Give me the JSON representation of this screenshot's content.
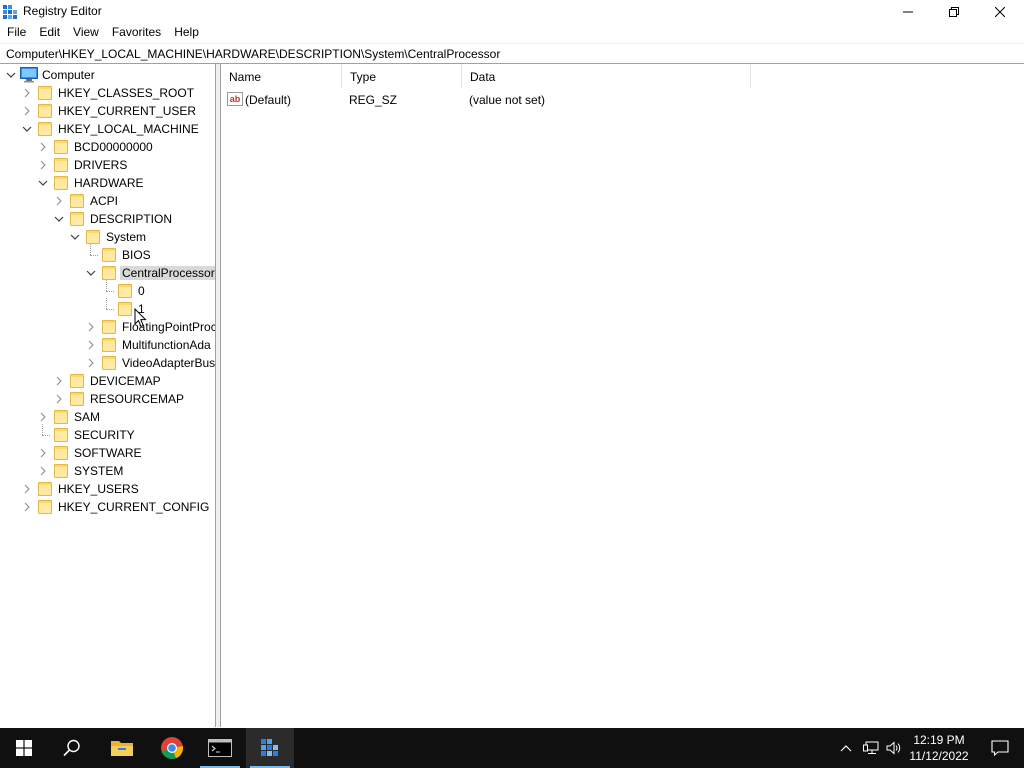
{
  "window": {
    "title": "Registry Editor",
    "icon": "regedit-icon",
    "controls": {
      "minimize": "minimize-icon",
      "maximize": "restore-icon",
      "close": "close-icon"
    }
  },
  "menu": [
    "File",
    "Edit",
    "View",
    "Favorites",
    "Help"
  ],
  "address": "Computer\\HKEY_LOCAL_MACHINE\\HARDWARE\\DESCRIPTION\\System\\CentralProcessor",
  "tree": [
    {
      "label": "Computer",
      "depth": 0,
      "state": "expanded",
      "icon": "computer-icon"
    },
    {
      "label": "HKEY_CLASSES_ROOT",
      "depth": 1,
      "state": "collapsed"
    },
    {
      "label": "HKEY_CURRENT_USER",
      "depth": 1,
      "state": "collapsed"
    },
    {
      "label": "HKEY_LOCAL_MACHINE",
      "depth": 1,
      "state": "expanded"
    },
    {
      "label": "BCD00000000",
      "depth": 2,
      "state": "collapsed"
    },
    {
      "label": "DRIVERS",
      "depth": 2,
      "state": "collapsed"
    },
    {
      "label": "HARDWARE",
      "depth": 2,
      "state": "expanded"
    },
    {
      "label": "ACPI",
      "depth": 3,
      "state": "collapsed"
    },
    {
      "label": "DESCRIPTION",
      "depth": 3,
      "state": "expanded"
    },
    {
      "label": "System",
      "depth": 4,
      "state": "expanded"
    },
    {
      "label": "BIOS",
      "depth": 5,
      "state": "leaf"
    },
    {
      "label": "CentralProcessor",
      "depth": 5,
      "state": "expanded",
      "selected": true
    },
    {
      "label": "0",
      "depth": 6,
      "state": "leaf"
    },
    {
      "label": "1",
      "depth": 6,
      "state": "leaf"
    },
    {
      "label": "FloatingPointProc",
      "depth": 5,
      "state": "collapsed"
    },
    {
      "label": "MultifunctionAda",
      "depth": 5,
      "state": "collapsed"
    },
    {
      "label": "VideoAdapterBus",
      "depth": 5,
      "state": "collapsed"
    },
    {
      "label": "DEVICEMAP",
      "depth": 3,
      "state": "collapsed"
    },
    {
      "label": "RESOURCEMAP",
      "depth": 3,
      "state": "collapsed"
    },
    {
      "label": "SAM",
      "depth": 2,
      "state": "collapsed"
    },
    {
      "label": "SECURITY",
      "depth": 2,
      "state": "leaf"
    },
    {
      "label": "SOFTWARE",
      "depth": 2,
      "state": "collapsed"
    },
    {
      "label": "SYSTEM",
      "depth": 2,
      "state": "collapsed"
    },
    {
      "label": "HKEY_USERS",
      "depth": 1,
      "state": "collapsed"
    },
    {
      "label": "HKEY_CURRENT_CONFIG",
      "depth": 1,
      "state": "collapsed"
    }
  ],
  "list": {
    "columns": [
      "Name",
      "Type",
      "Data"
    ],
    "rows": [
      {
        "icon": "string-value-icon",
        "icon_text": "ab",
        "name": "(Default)",
        "type": "REG_SZ",
        "data": "(value not set)"
      }
    ]
  },
  "taskbar": {
    "items": [
      "start-icon",
      "search-icon",
      "file-explorer-icon",
      "chrome-icon",
      "command-prompt-icon",
      "regedit-icon"
    ],
    "active": "regedit-icon",
    "tray": [
      "chevron-up-icon",
      "network-icon",
      "volume-icon",
      "notification-icon"
    ],
    "time": "12:19 PM",
    "date": "11/12/2022"
  },
  "colors": {
    "selection": "#d9d9d9",
    "folder": "#ffd86b",
    "taskbar": "#101010",
    "accent": "#76b9ed"
  }
}
